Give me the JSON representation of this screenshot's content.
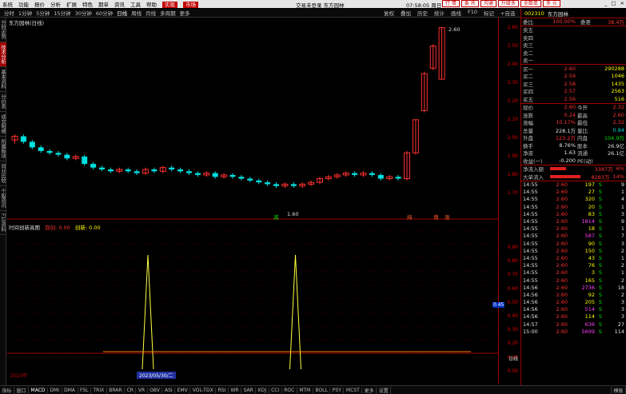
{
  "titlebar": {
    "menus": [
      "系统",
      "功能",
      "报价",
      "分析",
      "扩展",
      "特色",
      "期单",
      "资讯",
      "工具",
      "帮助"
    ],
    "highlights": [
      "实现",
      "市场"
    ],
    "center": "交易未登录  东方园林",
    "time": "07:58:05 周日",
    "buttons": [
      "行 情",
      "委 托",
      "沟通",
      "升级多",
      "全数单",
      "多 元"
    ]
  },
  "toolbar": {
    "periods": [
      "分时",
      "1分钟",
      "5分钟",
      "15分钟",
      "30分钟",
      "60分钟",
      "日线",
      "周线",
      "月线",
      "多周期",
      "更多"
    ],
    "selected": "日线",
    "right": [
      "复权",
      "叠加",
      "历史",
      "统计",
      "画线",
      "F10",
      "标记",
      "+自选",
      "返回"
    ]
  },
  "lefttabs": [
    "分时走势",
    "技术分析",
    "基本资料",
    "分价表",
    "成交明细",
    "所属板块",
    "同业比较",
    "个股资讯",
    "F10资料"
  ],
  "chart": {
    "title": "东方园林(日线)",
    "indicator_name": "时间创新高图",
    "indicator_p1": "双创: 0.00",
    "indicator_p2": "创新: 0.00",
    "high_label": "2.60",
    "low_label": "1.60",
    "marks": [
      "减",
      "持",
      "增",
      "涨"
    ],
    "start_year": "2023年",
    "cursor_date": "2023/05/30/二"
  },
  "axis": {
    "price_ticks": [
      "2.60",
      "2.50",
      "2.40",
      "2.30",
      "2.20",
      "2.10",
      "2.00",
      "1.90",
      "1.80",
      "1.70"
    ],
    "ind_ticks": [
      "0.90",
      "0.80",
      "0.70",
      "0.60",
      "0.50",
      "0.40",
      "0.30",
      "0.20",
      "0.10",
      "0.00"
    ],
    "ind_tag": "0.45",
    "unit": "日线"
  },
  "panel": {
    "code": "002310",
    "name": "东方园林",
    "weibi_label": "委比",
    "weibi": "100.00%",
    "weicha_label": "委差",
    "weicha": "38.4万",
    "sells": [
      {
        "label": "卖五",
        "price": "",
        "vol": ""
      },
      {
        "label": "卖四",
        "price": "",
        "vol": ""
      },
      {
        "label": "卖三",
        "price": "",
        "vol": ""
      },
      {
        "label": "卖二",
        "price": "",
        "vol": ""
      },
      {
        "label": "卖一",
        "price": "",
        "vol": ""
      }
    ],
    "buys": [
      {
        "label": "买一",
        "price": "2.60",
        "vol": "290288"
      },
      {
        "label": "买二",
        "price": "2.59",
        "vol": "1046"
      },
      {
        "label": "买三",
        "price": "2.58",
        "vol": "1435"
      },
      {
        "label": "买四",
        "price": "2.57",
        "vol": "2563"
      },
      {
        "label": "买五",
        "price": "2.56",
        "vol": "516"
      }
    ],
    "stats": [
      {
        "l1": "现价",
        "v1": "2.60",
        "l2": "今开",
        "v2": "2.32"
      },
      {
        "l1": "涨跌",
        "v1": "0.24",
        "l2": "最高",
        "v2": "2.60"
      },
      {
        "l1": "涨幅",
        "v1": "10.17%",
        "l2": "最低",
        "v2": "2.32"
      },
      {
        "l1": "总量",
        "v1": "228.1万",
        "l2": "量比",
        "v2": "0.84"
      },
      {
        "l1": "外盘",
        "v1": "123.2万",
        "l2": "内盘",
        "v2": "104.9万"
      },
      {
        "l1": "换手",
        "v1": "8.76%",
        "l2": "股本",
        "v2": "26.9亿"
      },
      {
        "l1": "净资",
        "v1": "1.63",
        "l2": "流通",
        "v2": "26.1亿"
      },
      {
        "l1": "收益(一)",
        "v1": "-0.200",
        "l2": "PE(动)",
        "v2": ""
      }
    ],
    "flows": [
      {
        "label": "净流入额",
        "value": "3387万",
        "pct": "6%"
      },
      {
        "label": "大单流入",
        "value": "8283万",
        "pct": "14%"
      }
    ],
    "ticks": [
      {
        "t": "14:55",
        "p": "2.60",
        "v": "197",
        "s": "S",
        "n": "9"
      },
      {
        "t": "14:55",
        "p": "2.60",
        "v": "27",
        "s": "S",
        "n": "1"
      },
      {
        "t": "14:55",
        "p": "2.60",
        "v": "320",
        "s": "S",
        "n": "4"
      },
      {
        "t": "14:55",
        "p": "2.60",
        "v": "20",
        "s": "S",
        "n": "1"
      },
      {
        "t": "14:55",
        "p": "2.60",
        "v": "83",
        "s": "S",
        "n": "3"
      },
      {
        "t": "14:55",
        "p": "2.60",
        "v": "1814",
        "s": "S",
        "n": "9"
      },
      {
        "t": "14:55",
        "p": "2.60",
        "v": "18",
        "s": "S",
        "n": "1"
      },
      {
        "t": "14:55",
        "p": "2.60",
        "v": "587",
        "s": "S",
        "n": "7"
      },
      {
        "t": "14:55",
        "p": "2.60",
        "v": "90",
        "s": "S",
        "n": "3"
      },
      {
        "t": "14:55",
        "p": "2.60",
        "v": "150",
        "s": "S",
        "n": "2"
      },
      {
        "t": "14:55",
        "p": "2.60",
        "v": "43",
        "s": "S",
        "n": "1"
      },
      {
        "t": "14:55",
        "p": "2.60",
        "v": "76",
        "s": "S",
        "n": "2"
      },
      {
        "t": "14:55",
        "p": "2.60",
        "v": "3",
        "s": "S",
        "n": "1"
      },
      {
        "t": "14:55",
        "p": "2.60",
        "v": "165",
        "s": "S",
        "n": "2"
      },
      {
        "t": "14:56",
        "p": "2.60",
        "v": "2736",
        "s": "S",
        "n": "18"
      },
      {
        "t": "14:56",
        "p": "2.60",
        "v": "92",
        "s": "S",
        "n": "2"
      },
      {
        "t": "14:56",
        "p": "2.60",
        "v": "205",
        "s": "S",
        "n": "3"
      },
      {
        "t": "14:56",
        "p": "2.60",
        "v": "514",
        "s": "S",
        "n": "3"
      },
      {
        "t": "14:56",
        "p": "2.60",
        "v": "114",
        "s": "S",
        "n": "3"
      },
      {
        "t": "14:57",
        "p": "2.60",
        "v": "636",
        "s": "S",
        "n": "27"
      },
      {
        "t": "15:00",
        "p": "2.60",
        "v": "5699",
        "s": "S",
        "n": "114"
      }
    ]
  },
  "bottombar": {
    "tabs": [
      "指标",
      "窗口",
      "MACD",
      "DMI",
      "DMA",
      "FSL",
      "TRIX",
      "BRAR",
      "CR",
      "VR",
      "OBV",
      "ASI",
      "EMV",
      "VOL-TDX",
      "RSI",
      "WR",
      "SAR",
      "KDJ",
      "CCI",
      "ROC",
      "MTM",
      "BOLL",
      "PSY",
      "MCST",
      "更多",
      "设置"
    ],
    "right": "模板"
  },
  "chart_data": {
    "type": "candlestick",
    "ylim": [
      1.6,
      2.62
    ],
    "candles": [
      [
        1.99,
        2.01,
        1.97,
        2.02
      ],
      [
        2.01,
        1.98,
        1.97,
        2.02
      ],
      [
        1.98,
        1.95,
        1.94,
        1.99
      ],
      [
        1.95,
        1.93,
        1.92,
        1.96
      ],
      [
        1.93,
        1.92,
        1.91,
        1.94
      ],
      [
        1.92,
        1.91,
        1.9,
        1.93
      ],
      [
        1.91,
        1.89,
        1.88,
        1.92
      ],
      [
        1.89,
        1.9,
        1.88,
        1.91
      ],
      [
        1.9,
        1.86,
        1.85,
        1.91
      ],
      [
        1.86,
        1.84,
        1.83,
        1.87
      ],
      [
        1.84,
        1.83,
        1.82,
        1.85
      ],
      [
        1.83,
        1.82,
        1.81,
        1.84
      ],
      [
        1.82,
        1.83,
        1.81,
        1.84
      ],
      [
        1.83,
        1.82,
        1.81,
        1.84
      ],
      [
        1.82,
        1.81,
        1.8,
        1.83
      ],
      [
        1.81,
        1.83,
        1.8,
        1.84
      ],
      [
        1.83,
        1.82,
        1.81,
        1.84
      ],
      [
        1.82,
        1.84,
        1.81,
        1.85
      ],
      [
        1.84,
        1.83,
        1.82,
        1.85
      ],
      [
        1.83,
        1.82,
        1.81,
        1.84
      ],
      [
        1.82,
        1.81,
        1.8,
        1.83
      ],
      [
        1.81,
        1.8,
        1.79,
        1.82
      ],
      [
        1.8,
        1.81,
        1.79,
        1.82
      ],
      [
        1.81,
        1.79,
        1.78,
        1.82
      ],
      [
        1.79,
        1.8,
        1.78,
        1.81
      ],
      [
        1.8,
        1.79,
        1.78,
        1.81
      ],
      [
        1.79,
        1.78,
        1.77,
        1.8
      ],
      [
        1.78,
        1.77,
        1.76,
        1.79
      ],
      [
        1.77,
        1.76,
        1.75,
        1.78
      ],
      [
        1.76,
        1.75,
        1.74,
        1.77
      ],
      [
        1.75,
        1.74,
        1.73,
        1.76
      ],
      [
        1.74,
        1.75,
        1.73,
        1.76
      ],
      [
        1.75,
        1.74,
        1.73,
        1.76
      ],
      [
        1.74,
        1.75,
        1.73,
        1.76
      ],
      [
        1.75,
        1.76,
        1.74,
        1.77
      ],
      [
        1.76,
        1.78,
        1.75,
        1.79
      ],
      [
        1.78,
        1.79,
        1.77,
        1.8
      ],
      [
        1.79,
        1.8,
        1.78,
        1.81
      ],
      [
        1.8,
        1.81,
        1.79,
        1.82
      ],
      [
        1.81,
        1.8,
        1.79,
        1.82
      ],
      [
        1.8,
        1.81,
        1.79,
        1.82
      ],
      [
        1.81,
        1.8,
        1.79,
        1.82
      ],
      [
        1.8,
        1.78,
        1.77,
        1.81
      ],
      [
        1.78,
        1.79,
        1.77,
        1.8
      ],
      [
        1.79,
        1.78,
        1.77,
        1.8
      ],
      [
        1.78,
        1.92,
        1.77,
        1.93
      ],
      [
        1.92,
        2.1,
        1.91,
        2.1
      ],
      [
        2.15,
        2.35,
        2.14,
        2.36
      ],
      [
        2.38,
        2.5,
        2.37,
        2.51
      ],
      [
        2.32,
        2.6,
        2.32,
        2.6
      ]
    ],
    "indicator": {
      "name": "时间创新高图",
      "peaks_at": [
        16,
        31
      ],
      "peak_value": 1.0
    }
  }
}
